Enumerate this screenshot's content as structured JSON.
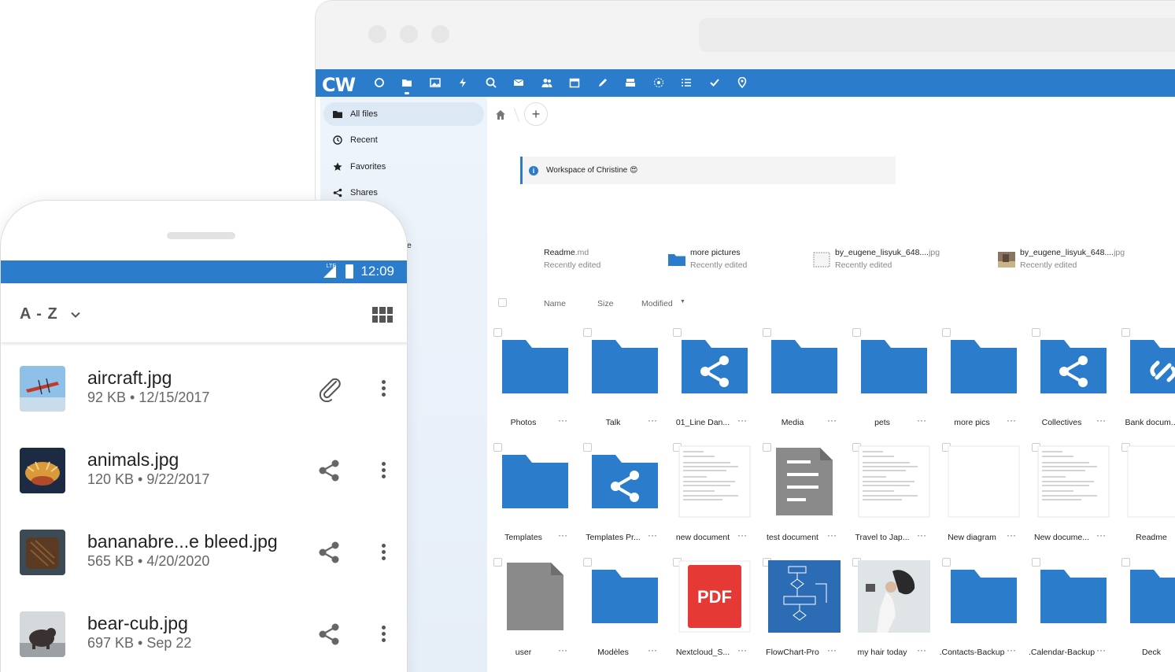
{
  "browser": {
    "logo": "CW",
    "sidebar": [
      {
        "label": "All files",
        "icon": "folder-icon"
      },
      {
        "label": "Recent",
        "icon": "clock-icon"
      },
      {
        "label": "Favorites",
        "icon": "star-icon"
      },
      {
        "label": "Shares",
        "icon": "share-icon"
      }
    ],
    "sidebar_partial": "e",
    "banner": "Workspace of Christine 😍",
    "recent": [
      {
        "name": "Readme",
        "ext": ".md",
        "sub": "Recently edited"
      },
      {
        "name": "more pictures",
        "ext": "",
        "sub": "Recently edited"
      },
      {
        "name": "by_eugene_lisyuk_648....",
        "ext": "jpg",
        "sub": "Recently edited"
      },
      {
        "name": "by_eugene_lisyuk_648....",
        "ext": "jpg",
        "sub": "Recently edited"
      }
    ],
    "columns": {
      "name": "Name",
      "size": "Size",
      "modified": "Modified"
    },
    "more": "···",
    "tiles": [
      {
        "name": "Photos",
        "type": "folder"
      },
      {
        "name": "Talk",
        "type": "folder"
      },
      {
        "name": "01_Line Dan...",
        "type": "shared"
      },
      {
        "name": "Media",
        "type": "folder"
      },
      {
        "name": "pets",
        "type": "folder"
      },
      {
        "name": "more pics",
        "type": "folder"
      },
      {
        "name": "Collectives",
        "type": "shared"
      },
      {
        "name": "Bank docum...",
        "type": "link"
      },
      {
        "name": "Templates",
        "type": "folder"
      },
      {
        "name": "Templates Pr...",
        "type": "shared"
      },
      {
        "name": "new document",
        "type": "doc"
      },
      {
        "name": "test document",
        "type": "gray-doc"
      },
      {
        "name": "Travel to Jap...",
        "type": "doc"
      },
      {
        "name": "New diagram",
        "type": "blank"
      },
      {
        "name": "New docume...",
        "type": "doc"
      },
      {
        "name": "Readme",
        "type": "blank"
      },
      {
        "name": "user",
        "type": "gray-doc"
      },
      {
        "name": "Modèles",
        "type": "folder"
      },
      {
        "name": "Nextcloud_S...",
        "type": "pdf"
      },
      {
        "name": "FlowChart-Pro",
        "type": "flow"
      },
      {
        "name": "my hair today",
        "type": "photo"
      },
      {
        "name": ".Contacts-Backup",
        "type": "folder"
      },
      {
        "name": ".Calendar-Backup",
        "type": "folder"
      },
      {
        "name": "Deck",
        "type": "folder"
      }
    ],
    "pdf_label": "PDF"
  },
  "phone": {
    "status": {
      "network": "LTE",
      "time": "12:09"
    },
    "sort": "A - Z",
    "files": [
      {
        "name": "aircraft.jpg",
        "meta": "92 KB • 12/15/2017",
        "action": "paperclip-icon"
      },
      {
        "name": "animals.jpg",
        "meta": "120 KB • 9/22/2017",
        "action": "share-icon"
      },
      {
        "name": "bananabre...e bleed.jpg",
        "meta": "565 KB • 4/20/2020",
        "action": "share-icon"
      },
      {
        "name": "bear-cub.jpg",
        "meta": "697 KB • Sep 22",
        "action": "share-icon"
      }
    ]
  },
  "colors": {
    "accent": "#2b7cca",
    "folder": "#2b7cca"
  }
}
